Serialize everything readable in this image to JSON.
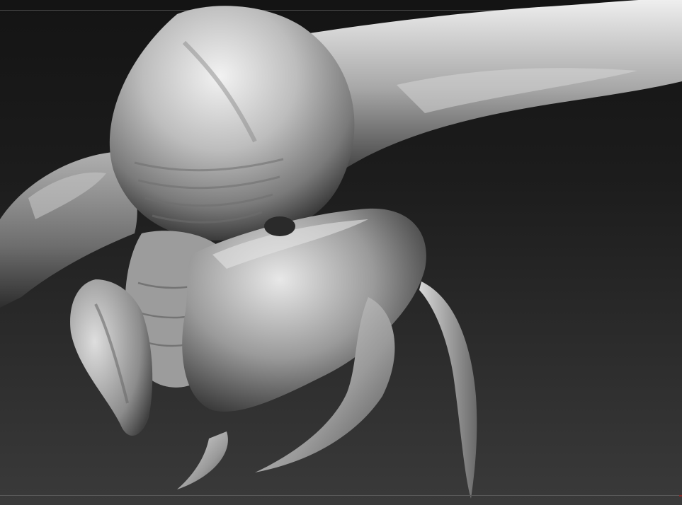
{
  "canvas": {
    "background_top": "#141414",
    "background_bottom": "#3a3a3a",
    "frame_line_color": "#4a4a4a",
    "marker_color": "#8a2a2a"
  },
  "model": {
    "material_color": "#c8c8c8",
    "highlight_color": "#f0f0f0",
    "shadow_color": "#2a2a2a"
  }
}
